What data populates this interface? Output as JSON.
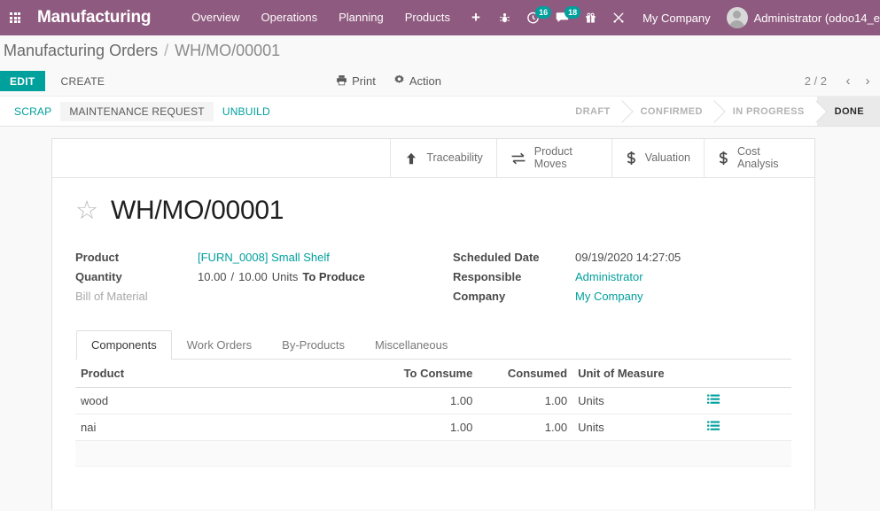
{
  "navbar": {
    "apps_icon": "grid-apps-icon",
    "brand": "Manufacturing",
    "menus": [
      {
        "label": "Overview"
      },
      {
        "label": "Operations"
      },
      {
        "label": "Planning"
      },
      {
        "label": "Products"
      }
    ],
    "plus_label": "+",
    "sys_icons": [
      {
        "name": "bug-icon",
        "badge": null
      },
      {
        "name": "activity-clock-icon",
        "badge": "16"
      },
      {
        "name": "messages-icon",
        "badge": "18"
      },
      {
        "name": "gift-icon",
        "badge": null
      },
      {
        "name": "tools-icon",
        "badge": null
      }
    ],
    "company": "My Company",
    "user": "Administrator (odoo14_e",
    "background_color": "#8f5a7f",
    "badge_color": "#00a09d"
  },
  "breadcrumb": {
    "parent": "Manufacturing Orders",
    "separator": "/",
    "current": "WH/MO/00001"
  },
  "control_panel": {
    "edit_label": "EDIT",
    "create_label": "CREATE",
    "print_label": "Print",
    "action_label": "Action",
    "pager_count": "2 / 2",
    "prev_label": "‹",
    "next_label": "›",
    "edit_button_color": "#00a09d"
  },
  "status_bar": {
    "buttons": [
      {
        "label": "SCRAP",
        "state": "link"
      },
      {
        "label": "MAINTENANCE REQUEST",
        "state": "hovered"
      },
      {
        "label": "UNBUILD",
        "state": "link"
      }
    ],
    "stages": [
      {
        "label": "DRAFT",
        "active": false
      },
      {
        "label": "CONFIRMED",
        "active": false
      },
      {
        "label": "IN PROGRESS",
        "active": false
      },
      {
        "label": "DONE",
        "active": true
      }
    ]
  },
  "smart_buttons": [
    {
      "label": "Traceability",
      "icon": "up-arrow-icon"
    },
    {
      "label": "Product Moves",
      "icon": "exchange-arrows-icon"
    },
    {
      "label": "Valuation",
      "icon": "dollar-icon"
    },
    {
      "label": "Cost Analysis",
      "icon": "dollar-icon"
    }
  ],
  "record": {
    "star_icon": "star-outline-icon",
    "title": "WH/MO/00001",
    "fields_left": [
      {
        "label": "Product",
        "value": "[FURN_0008] Small Shelf",
        "type": "link"
      },
      {
        "label": "Quantity",
        "value": "10.00",
        "value2": "10.00",
        "sep": "/",
        "unit": "Units",
        "suffix": "To Produce",
        "type": "quantity"
      },
      {
        "label": "Bill of Material",
        "value": "",
        "type": "muted"
      }
    ],
    "fields_right": [
      {
        "label": "Scheduled Date",
        "value": "09/19/2020 14:27:05",
        "type": "text"
      },
      {
        "label": "Responsible",
        "value": "Administrator",
        "type": "link"
      },
      {
        "label": "Company",
        "value": "My Company",
        "type": "link"
      }
    ]
  },
  "notebook": {
    "tabs": [
      {
        "label": "Components",
        "active": true
      },
      {
        "label": "Work Orders",
        "active": false
      },
      {
        "label": "By-Products",
        "active": false
      },
      {
        "label": "Miscellaneous",
        "active": false
      }
    ],
    "table": {
      "columns": [
        {
          "label": "Product",
          "align": "left"
        },
        {
          "label": "To Consume",
          "align": "right"
        },
        {
          "label": "Consumed",
          "align": "right"
        },
        {
          "label": "Unit of Measure",
          "align": "left"
        },
        {
          "label": "",
          "align": "left"
        }
      ],
      "rows": [
        {
          "product": "wood",
          "to_consume": "1.00",
          "consumed": "1.00",
          "uom": "Units",
          "action_icon": "list-details-icon"
        },
        {
          "product": "nai",
          "to_consume": "1.00",
          "consumed": "1.00",
          "uom": "Units",
          "action_icon": "list-details-icon"
        }
      ]
    }
  }
}
